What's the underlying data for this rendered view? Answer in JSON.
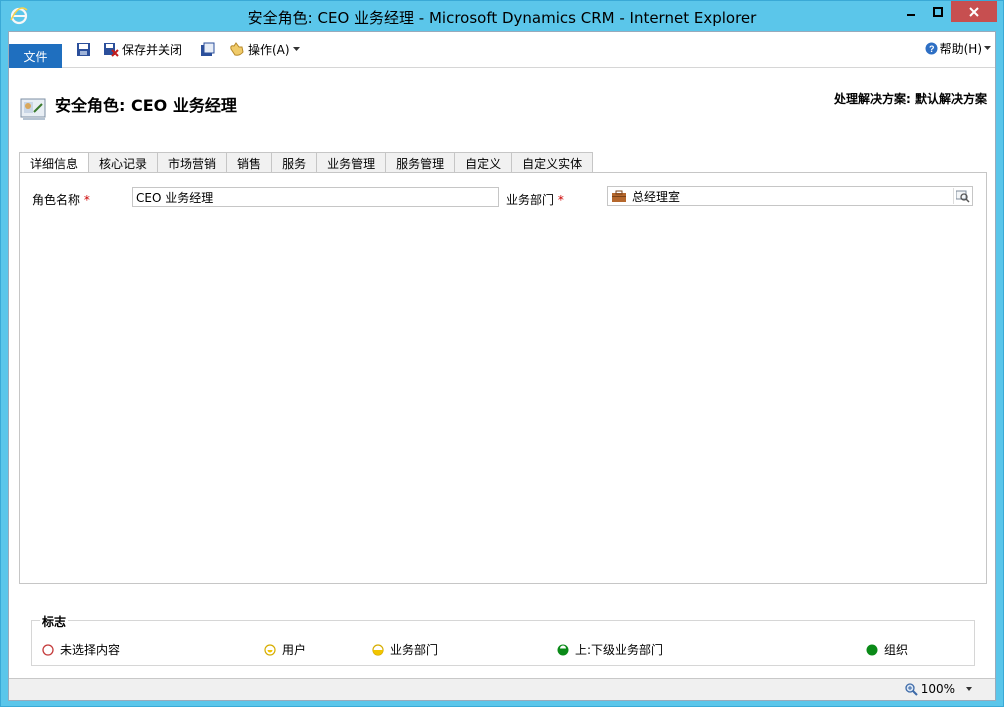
{
  "window": {
    "title": "安全角色: CEO 业务经理 - Microsoft Dynamics CRM - Internet Explorer"
  },
  "ribbon": {
    "file_label": "文件",
    "save_close_label": "保存并关闭",
    "actions_label": "操作(A)",
    "help_label": "帮助(H)"
  },
  "header": {
    "page_title": "安全角色: CEO 业务经理",
    "solution_label": "处理解决方案: 默认解决方案"
  },
  "tabs": [
    {
      "label": "详细信息",
      "selected": true
    },
    {
      "label": "核心记录"
    },
    {
      "label": "市场营销"
    },
    {
      "label": "销售"
    },
    {
      "label": "服务"
    },
    {
      "label": "业务管理"
    },
    {
      "label": "服务管理"
    },
    {
      "label": "自定义"
    },
    {
      "label": "自定义实体"
    }
  ],
  "form": {
    "role_name_label": "角色名称",
    "role_name_value": "CEO 业务经理",
    "business_unit_label": "业务部门",
    "business_unit_value": "总经理室",
    "required_marker": "*"
  },
  "legend": {
    "title": "标志",
    "items": [
      {
        "label": "未选择内容",
        "icon": "empty-circle-icon"
      },
      {
        "label": "用户",
        "icon": "user-level-icon"
      },
      {
        "label": "业务部门",
        "icon": "business-unit-level-icon"
      },
      {
        "label": "上:下级业务部门",
        "icon": "parent-child-level-icon"
      },
      {
        "label": "组织",
        "icon": "organization-level-icon"
      }
    ]
  },
  "statusbar": {
    "zoom": "100%"
  },
  "colors": {
    "titlebar": "#5bc6ea",
    "file_button": "#1f6fbf",
    "close_button": "#c74f50",
    "required": "#cc0000",
    "user_yellow": "#f2c500",
    "org_green": "#0a8a18"
  }
}
